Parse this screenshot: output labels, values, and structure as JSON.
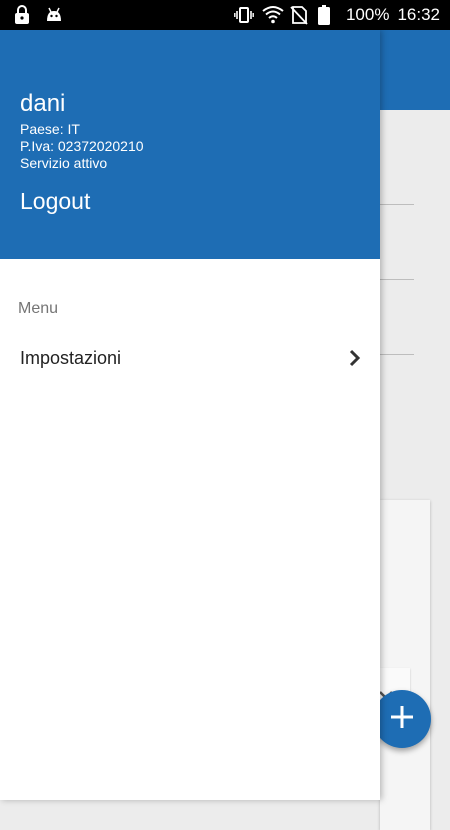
{
  "status_bar": {
    "battery_percent": "100%",
    "time": "16:32",
    "icons": [
      "lock-icon",
      "android-icon",
      "vibrate-icon",
      "wifi-icon",
      "no-sim-icon",
      "battery-icon"
    ]
  },
  "drawer": {
    "user": {
      "name": "dani",
      "country": "Paese: IT",
      "vat": "P.Iva: 02372020210",
      "service_status": "Servizio attivo"
    },
    "logout_label": "Logout",
    "section_title": "Menu",
    "items": [
      {
        "label": "Impostazioni",
        "icon": "chevron-right-icon"
      }
    ]
  },
  "background_app": {
    "fab_icon": "plus-icon",
    "accent_color": "#1e6db4"
  },
  "colors": {
    "primary": "#1e6db4",
    "drawer_bg": "#ffffff",
    "status_bar": "#000000"
  }
}
